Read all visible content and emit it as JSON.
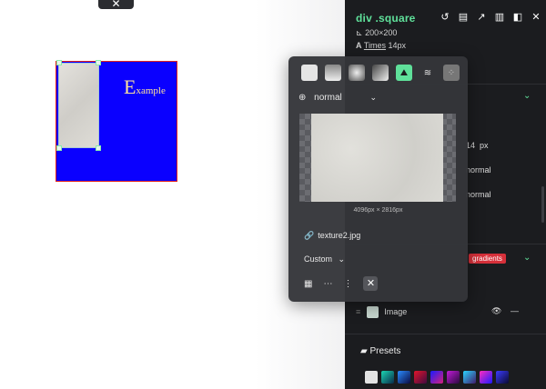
{
  "canvas": {
    "top_tab_icon": "close-icon",
    "top_tab_glyph": "✕",
    "example_first": "E",
    "example_rest": "xample"
  },
  "panel": {
    "selector": "div .square",
    "size": "200×200",
    "font_family": "Times",
    "font_size": "14px",
    "prop_14": "14",
    "prop_px": "px",
    "prop_normal_1": "normal",
    "prop_normal_2": "normal",
    "badge": "gradients",
    "layer_label": "Image",
    "presets_title": "Presets",
    "preset_colors": [
      "#e3e3e3",
      "#1bd6b2",
      "#2a8cff",
      "#e0152b",
      "#1a1aff",
      "#c01bd6",
      "#2ad6ff",
      "#ff2bbf",
      "#3b3bff"
    ]
  },
  "popup": {
    "blend_mode": "normal",
    "dimensions": "4096px × 2816px",
    "file_name": "texture2.jpg",
    "size_mode": "Custom",
    "accent": "#5fe09a"
  }
}
